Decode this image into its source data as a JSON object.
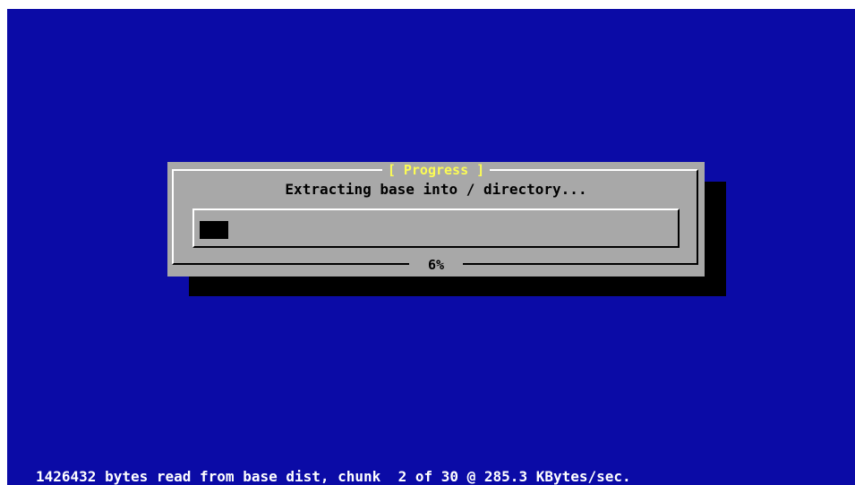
{
  "dialog": {
    "title": "[ Progress ]",
    "message": "Extracting base into / directory...",
    "progress_fraction": 0.06,
    "percent_label": "6%"
  },
  "status": {
    "text": "1426432 bytes read from base dist, chunk  2 of 30 @ 285.3 KBytes/sec."
  },
  "colors": {
    "background": "#0b0ba6",
    "dialog": "#a8a8a8",
    "title": "#fcfc54",
    "shadow": "#000000",
    "status_text": "#ffffff"
  }
}
